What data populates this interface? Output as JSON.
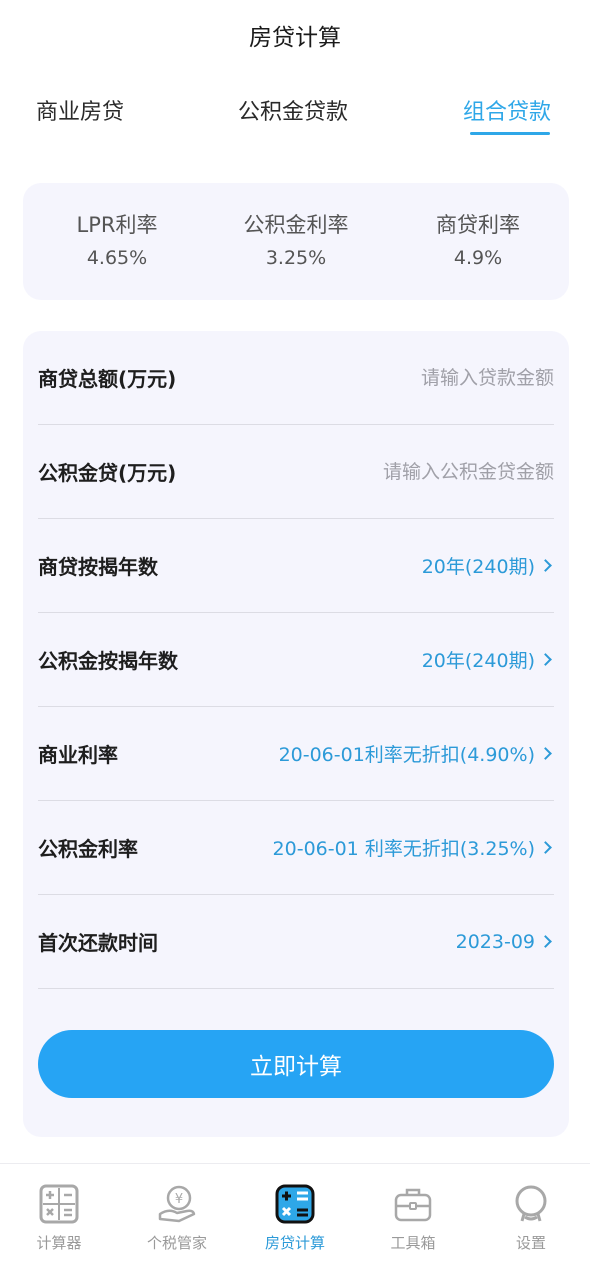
{
  "header": {
    "title": "房贷计算"
  },
  "tabs": [
    {
      "label": "商业房贷",
      "active": false
    },
    {
      "label": "公积金贷款",
      "active": false
    },
    {
      "label": "组合贷款",
      "active": true
    }
  ],
  "rates": [
    {
      "label": "LPR利率",
      "value": "4.65%"
    },
    {
      "label": "公积金利率",
      "value": "3.25%"
    },
    {
      "label": "商贷利率",
      "value": "4.9%"
    }
  ],
  "form": {
    "commercial_amount": {
      "label": "商贷总额(万元)",
      "placeholder": "请输入贷款金额",
      "value": ""
    },
    "fund_amount": {
      "label": "公积金贷(万元)",
      "placeholder": "请输入公积金贷金额",
      "value": ""
    },
    "commercial_years": {
      "label": "商贷按揭年数",
      "value": "20年(240期)"
    },
    "fund_years": {
      "label": "公积金按揭年数",
      "value": "20年(240期)"
    },
    "commercial_rate": {
      "label": "商业利率",
      "value": "20-06-01利率无折扣(4.90%)"
    },
    "fund_rate": {
      "label": "公积金利率",
      "value": "20-06-01 利率无折扣(3.25%)"
    },
    "first_payment": {
      "label": "首次还款时间",
      "value": "2023-09"
    }
  },
  "calculate_button": {
    "label": "立即计算"
  },
  "nav": [
    {
      "label": "计算器",
      "icon": "calculator-icon",
      "active": false
    },
    {
      "label": "个税管家",
      "icon": "tax-icon",
      "active": false
    },
    {
      "label": "房贷计算",
      "icon": "mortgage-calc-icon",
      "active": true
    },
    {
      "label": "工具箱",
      "icon": "toolbox-icon",
      "active": false
    },
    {
      "label": "设置",
      "icon": "settings-icon",
      "active": false
    }
  ],
  "colors": {
    "accent": "#2ea7e8",
    "button": "#26a4f4",
    "card_bg": "#f5f5fd",
    "nav_inactive": "#9a9a9a"
  }
}
